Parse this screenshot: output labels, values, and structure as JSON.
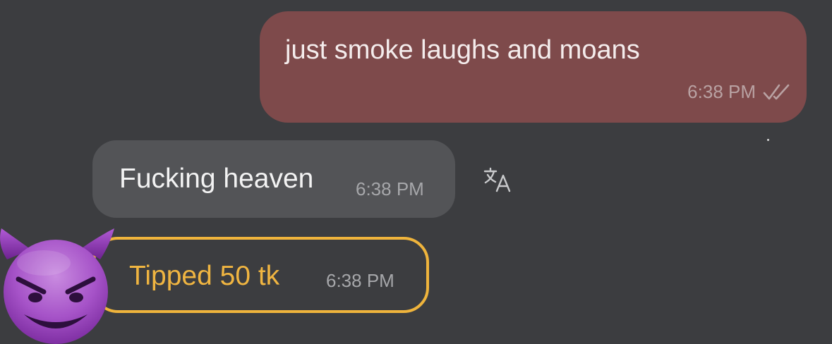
{
  "messages": {
    "outgoing": {
      "text": "just smoke laughs and moans",
      "time": "6:38 PM",
      "status_icon": "double-check-icon"
    },
    "incoming": {
      "text": "Fucking heaven",
      "time": "6:38 PM",
      "action_icon": "translate-icon"
    },
    "tip": {
      "text": "Tipped 50 tk",
      "time": "6:38 PM",
      "avatar_icon": "smiling-devil-emoji"
    }
  },
  "colors": {
    "background": "#3c3d40",
    "outgoing_bubble": "#7e4a4b",
    "incoming_bubble": "#535457",
    "tip_accent": "#efb43c"
  }
}
